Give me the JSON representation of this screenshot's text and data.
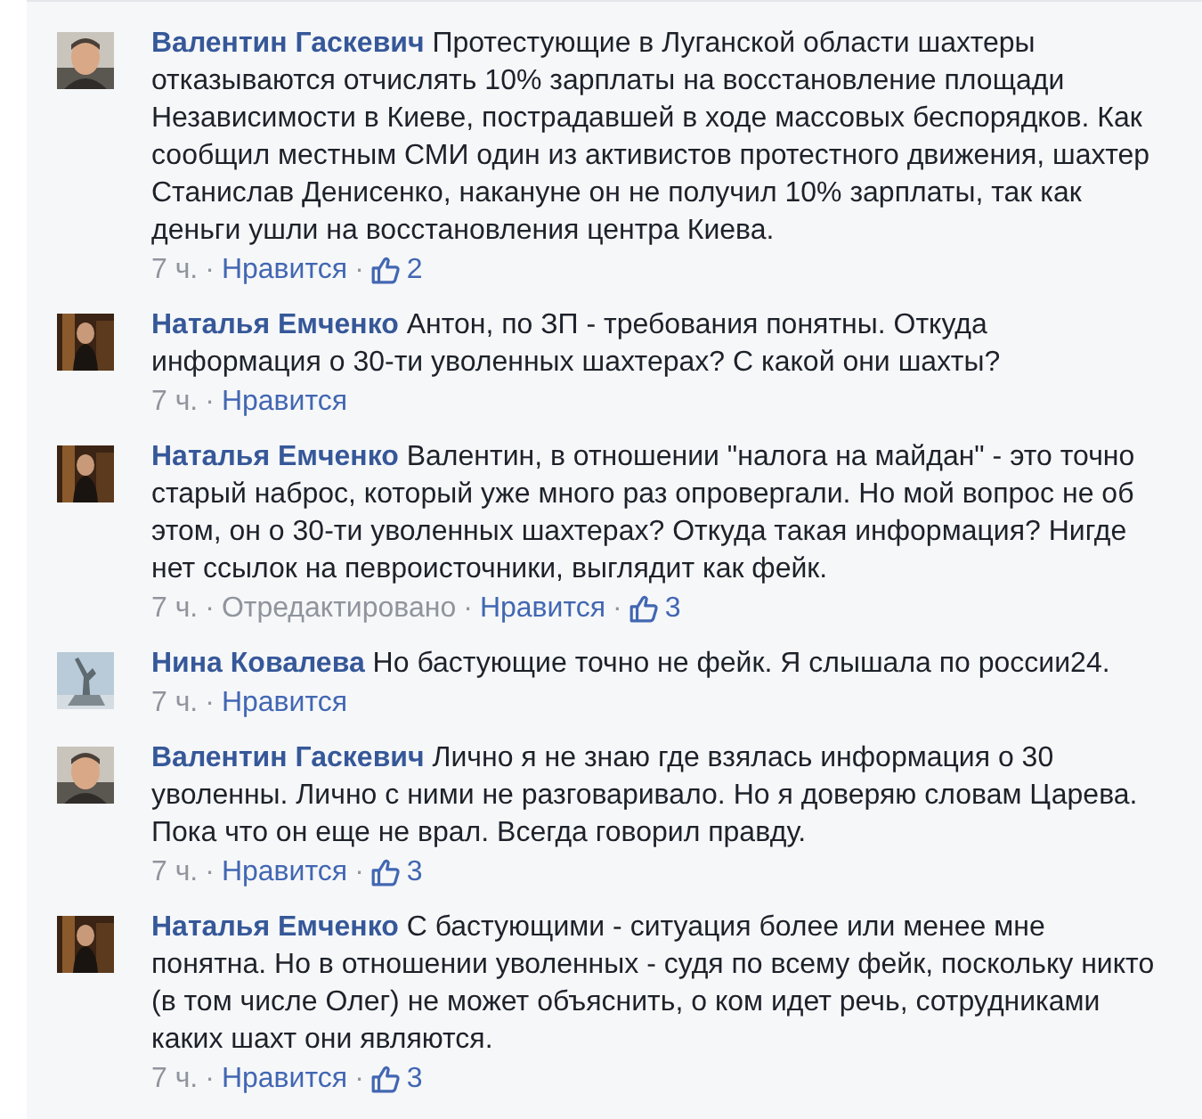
{
  "comments": [
    {
      "author": "Валентин Гаскевич",
      "text": "Протестующие в Луганской области шахтеры отказываются отчислять 10% зарплаты на восстановление площади Независимости в Киеве, пострадавшей в ходе массовых беспорядков. Как сообщил местным СМИ один из активистов протестного движения, шахтер Станислав Денисенко, накануне он не получил 10% зарплаты, так как деньги ушли на восстановления центра Киева.",
      "meta": [
        {
          "kind": "time",
          "text": "7 ч."
        },
        {
          "kind": "sep",
          "text": "·"
        },
        {
          "kind": "like",
          "text": "Нравится"
        },
        {
          "kind": "sep",
          "text": "·"
        },
        {
          "kind": "likes",
          "text": "2"
        }
      ]
    },
    {
      "author": "Наталья Емченко",
      "text": "Антон, по ЗП - требования понятны. Откуда информация о 30-ти уволенных шахтерах? С какой они шахты?",
      "meta": [
        {
          "kind": "time",
          "text": "7 ч."
        },
        {
          "kind": "sep",
          "text": "·"
        },
        {
          "kind": "like",
          "text": "Нравится"
        }
      ]
    },
    {
      "author": "Наталья Емченко",
      "text": "Валентин, в отношении \"налога на майдан\" - это точно старый наброс, который уже много раз опровергали. Но мой вопрос не об этом, он о 30-ти уволенных шахтерах? Откуда такая информация? Нигде нет ссылок на певроисточники, выглядит как фейк.",
      "meta": [
        {
          "kind": "time",
          "text": "7 ч."
        },
        {
          "kind": "sep",
          "text": "·"
        },
        {
          "kind": "edited",
          "text": "Отредактировано"
        },
        {
          "kind": "sep",
          "text": "·"
        },
        {
          "kind": "like",
          "text": "Нравится"
        },
        {
          "kind": "sep",
          "text": "·"
        },
        {
          "kind": "likes",
          "text": "3"
        }
      ]
    },
    {
      "author": "Нина Ковалева",
      "text": "Но бастующие точно не фейк. Я слышала по россии24.",
      "meta": [
        {
          "kind": "time",
          "text": "7 ч."
        },
        {
          "kind": "sep",
          "text": "·"
        },
        {
          "kind": "like",
          "text": "Нравится"
        }
      ]
    },
    {
      "author": "Валентин Гаскевич",
      "text": "Лично я не знаю где взялась информация о 30 уволенны. Лично с ними не разговаривало. Но я доверяю словам Царева. Пока что он еще не врал. Всегда говорил правду.",
      "meta": [
        {
          "kind": "time",
          "text": "7 ч."
        },
        {
          "kind": "sep",
          "text": "·"
        },
        {
          "kind": "like",
          "text": "Нравится"
        },
        {
          "kind": "sep",
          "text": "·"
        },
        {
          "kind": "likes",
          "text": "3"
        }
      ]
    },
    {
      "author": "Наталья Емченко",
      "text": "С бастующими - ситуация более или менее мне понятна. Но в отношении уволенных - судя по всему фейк, поскольку никто (в том числе Олег) не может объяснить, о ком идет речь, сотрудниками каких шахт они являются.",
      "meta": [
        {
          "kind": "time",
          "text": "7 ч."
        },
        {
          "kind": "sep",
          "text": "·"
        },
        {
          "kind": "like",
          "text": "Нравится"
        },
        {
          "kind": "sep",
          "text": "·"
        },
        {
          "kind": "likes",
          "text": "3"
        }
      ]
    }
  ]
}
